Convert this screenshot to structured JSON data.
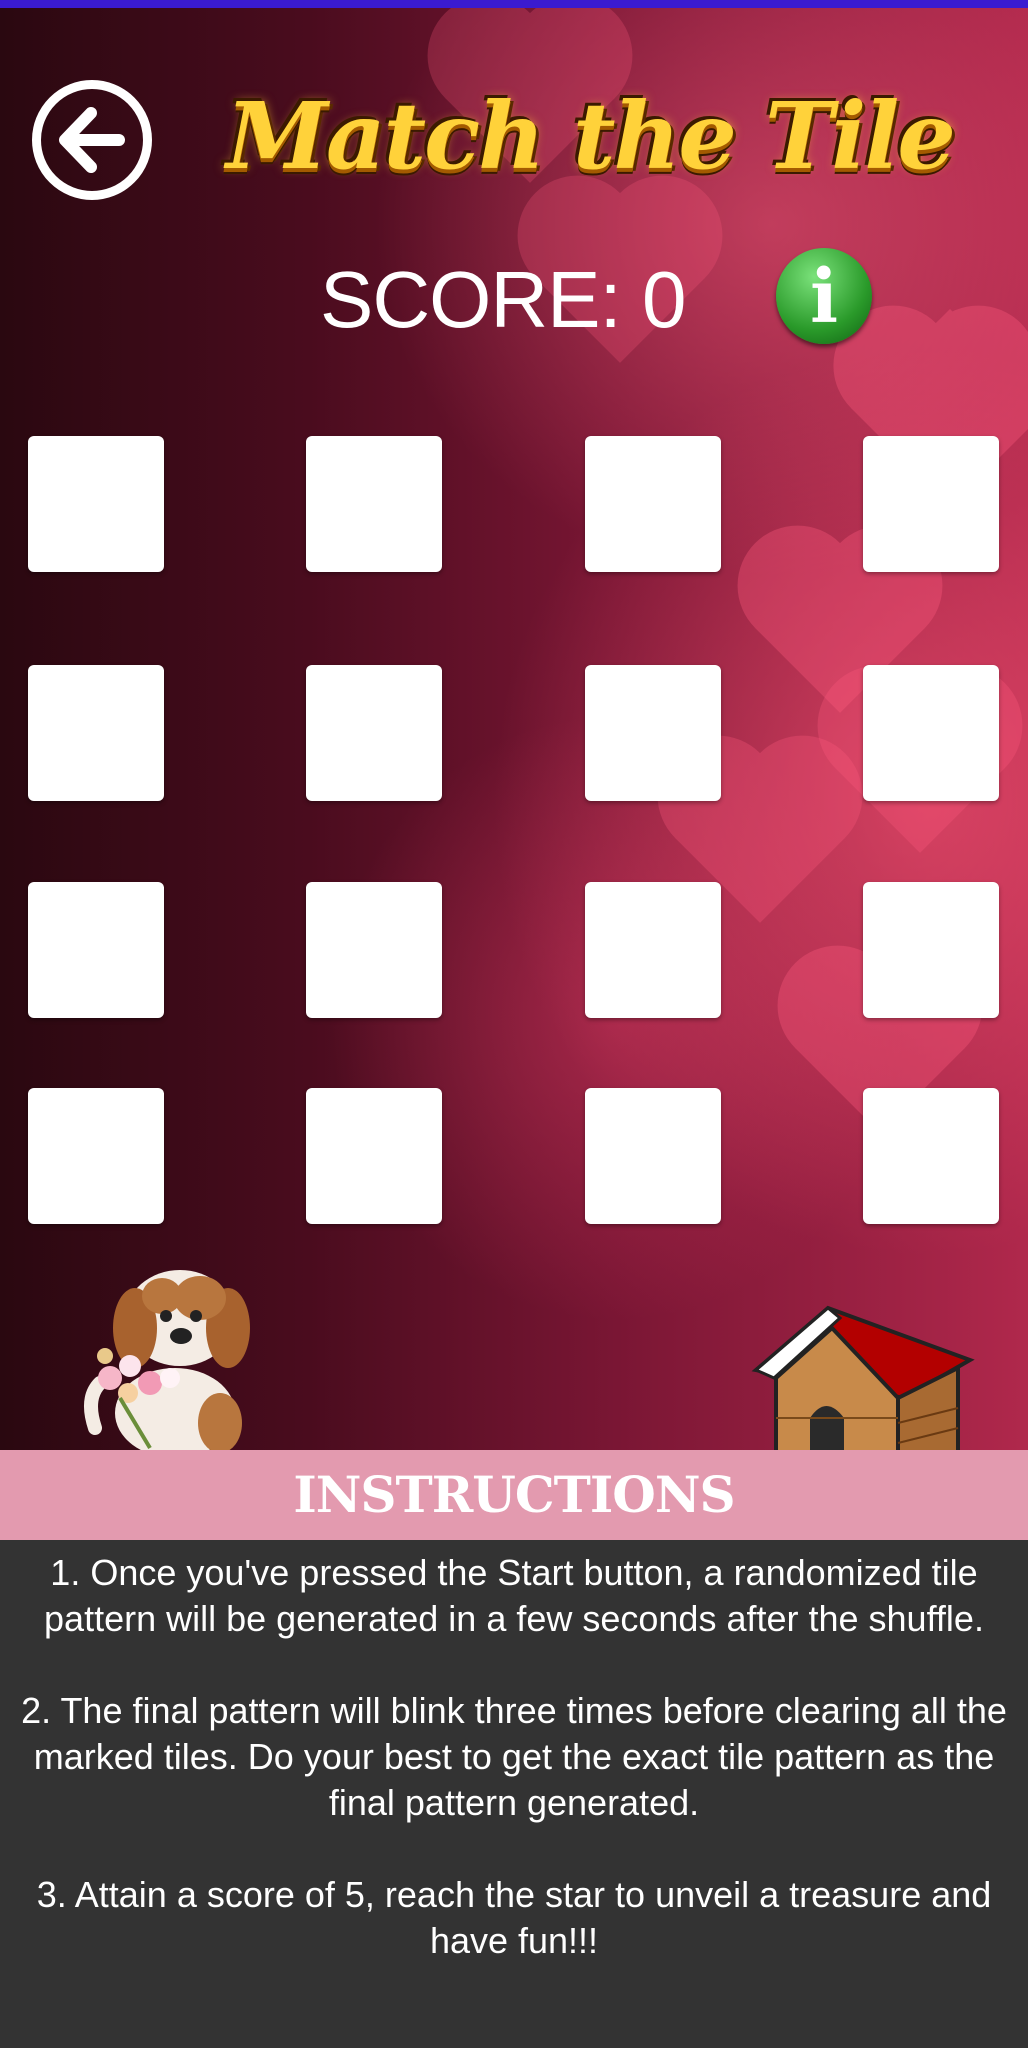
{
  "header": {
    "title": "Match the Tile",
    "score_label": "SCORE: 0",
    "info_icon": "i"
  },
  "icons": {
    "back": "back-arrow-icon",
    "info": "info-icon"
  },
  "board": {
    "rows": 4,
    "cols": 4
  },
  "instructions": {
    "heading": "INSTRUCTIONS",
    "items": [
      "1. Once you've pressed the Start button, a randomized tile pattern will be generated in a few seconds after the shuffle.",
      "2. The final pattern will blink three times before clearing all the marked tiles. Do your best to get the exact tile pattern as the final pattern generated.",
      "3. Attain a score of 5, reach the star to unveil a treasure and have fun!!!"
    ]
  },
  "colors": {
    "topbar": "#3a1bd0",
    "title": "#ffd23a",
    "instructions_header": "#e39aaf",
    "instructions_body": "#333333",
    "tile": "#ffffff",
    "info_button": "#2a9a2a"
  }
}
